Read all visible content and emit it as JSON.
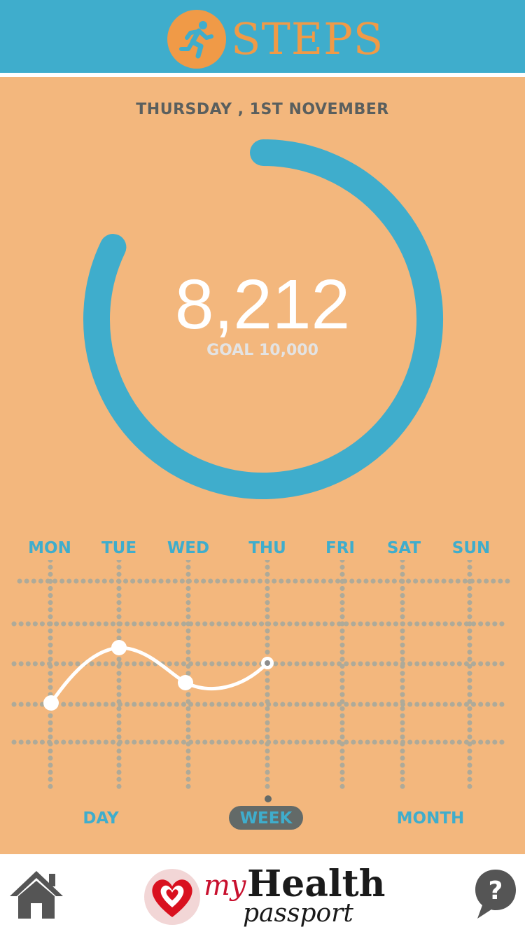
{
  "app": {
    "title": "STEPS",
    "logo_icon": "runner-icon"
  },
  "summary": {
    "date": "THURSDAY , 1ST NOVEMBER",
    "steps": "8,212",
    "goal_label": "GOAL 10,000",
    "progress_fraction": 0.8212
  },
  "colors": {
    "header": "#3fadcc",
    "accent": "#f09a47",
    "background": "#f3b77d",
    "ring": "#3fadcc",
    "range_active": "#636a68"
  },
  "week": {
    "days": [
      "MON",
      "TUE",
      "WED",
      "THU",
      "FRI",
      "SAT",
      "SUN"
    ]
  },
  "ranges": {
    "day": "DAY",
    "week": "WEEK",
    "month": "MONTH",
    "selected": "week"
  },
  "footer": {
    "home_icon": "home-icon",
    "help_icon": "help-speech-bubble-icon",
    "brand_my": "my",
    "brand_health": "Health",
    "brand_passport": "passport"
  }
}
